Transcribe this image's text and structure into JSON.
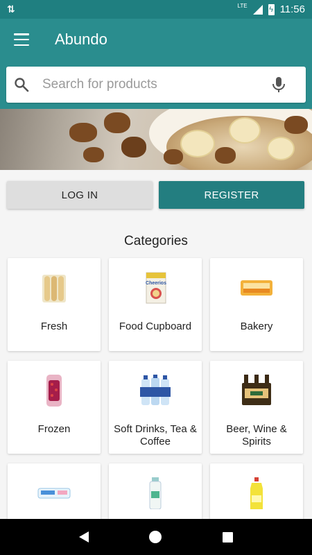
{
  "status_bar": {
    "time": "11:56",
    "network": "LTE"
  },
  "app_bar": {
    "title": "Abundo"
  },
  "search": {
    "placeholder": "Search for products"
  },
  "auth": {
    "login_label": "LOG IN",
    "register_label": "REGISTER"
  },
  "categories": {
    "heading": "Categories",
    "items": [
      {
        "label": "Fresh",
        "icon": "bread-rolls-icon"
      },
      {
        "label": "Food Cupboard",
        "icon": "cereal-box-icon"
      },
      {
        "label": "Bakery",
        "icon": "cake-icon"
      },
      {
        "label": "Frozen",
        "icon": "frozen-berries-icon"
      },
      {
        "label": "Soft Drinks, Tea & Coffee",
        "icon": "water-bottles-icon"
      },
      {
        "label": "Beer, Wine & Spirits",
        "icon": "beer-bottles-icon"
      },
      {
        "label": "",
        "icon": "wipes-icon"
      },
      {
        "label": "",
        "icon": "spray-can-icon"
      },
      {
        "label": "",
        "icon": "bleach-bottle-icon"
      }
    ]
  },
  "colors": {
    "primary": "#2a8d8e",
    "primary_dark": "#1f7f80",
    "register_button": "#237e80"
  }
}
